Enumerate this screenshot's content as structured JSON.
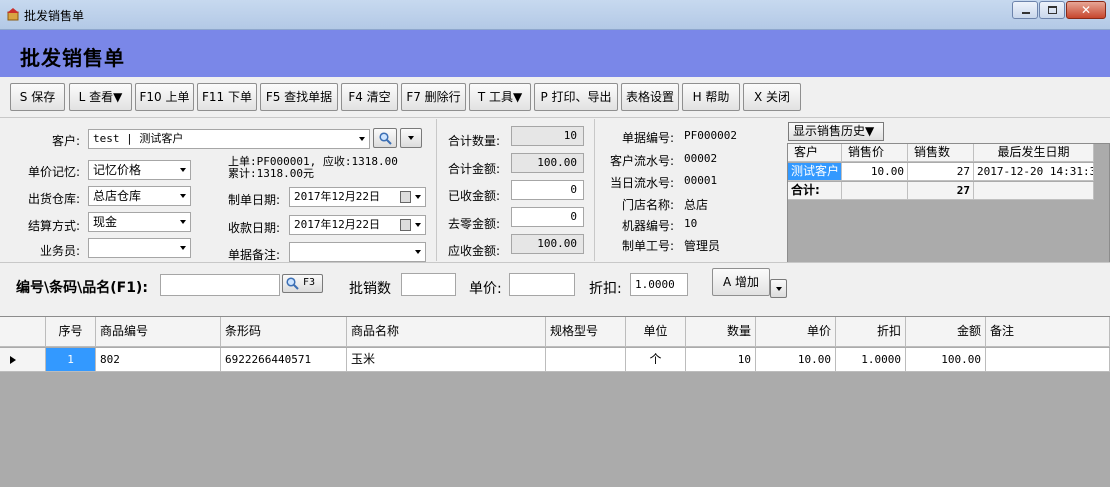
{
  "window": {
    "title": "批发销售单",
    "colors": {
      "header": "#7a87e8",
      "selected": "#3399ff"
    },
    "icons": [
      "app-icon",
      "minimize-icon",
      "maximize-icon",
      "close-icon"
    ]
  },
  "header": {
    "title": "批发销售单"
  },
  "toolbar": {
    "save": "S 保存",
    "view": "L 查看▼",
    "prev": "F10 上单",
    "next": "F11 下单",
    "find": "F5 查找单据",
    "clear": "F4 清空",
    "delete_row": "F7 删除行",
    "tools": "T 工具▼",
    "print": "P 打印、导出",
    "table_settings": "表格设置",
    "help": "H 帮助",
    "close": "X 关闭"
  },
  "form": {
    "customer_label": "客户:",
    "customer_value": "test | 测试客户",
    "price_memory_label": "单价记忆:",
    "price_memory_value": "记忆价格",
    "warehouse_label": "出货仓库:",
    "warehouse_value": "总店仓库",
    "settle_label": "结算方式:",
    "settle_value": "现金",
    "staff_label": "业务员:",
    "staff_value": "",
    "last_bill_line1": "上单:PF000001, 应收:1318.00",
    "last_bill_line2": "累计:1318.00元",
    "make_date_label": "制单日期:",
    "make_date_value": "2017年12月22日",
    "pay_date_label": "收款日期:",
    "pay_date_value": "2017年12月22日",
    "note_label": "单据备注:",
    "note_value": ""
  },
  "totals": {
    "qty_label": "合计数量:",
    "qty_value": "10",
    "amount_label": "合计金额:",
    "amount_value": "100.00",
    "received_label": "已收金额:",
    "received_value": "0",
    "rounding_label": "去零金额:",
    "rounding_value": "0",
    "receivable_label": "应收金额:",
    "receivable_value": "100.00"
  },
  "info": {
    "bill_no_label": "单据编号:",
    "bill_no_value": "PF000002",
    "cust_flow_label": "客户流水号:",
    "cust_flow_value": "00002",
    "day_flow_label": "当日流水号:",
    "day_flow_value": "00001",
    "store_label": "门店名称:",
    "store_value": "总店",
    "machine_label": "机器编号:",
    "machine_value": "10",
    "operator_label": "制单工号:",
    "operator_value": "管理员"
  },
  "history": {
    "button": "显示销售历史▼",
    "columns": [
      "客户",
      "销售价",
      "销售数",
      "最后发生日期"
    ],
    "row": [
      "测试客户",
      "10.00",
      "27",
      "2017-12-20 14:31:31"
    ],
    "total_label": "合计:",
    "total_qty": "27"
  },
  "entry": {
    "code_label": "编号\\条码\\品名(F1):",
    "code_value": "",
    "f3": "F3",
    "batch_label": "批销数",
    "batch_value": "",
    "price_label": "单价:",
    "price_value": "",
    "discount_label": "折扣:",
    "discount_value": "1.0000",
    "add_button": "A 增加"
  },
  "grid": {
    "columns": [
      "序号",
      "商品编号",
      "条形码",
      "商品名称",
      "规格型号",
      "单位",
      "数量",
      "单价",
      "折扣",
      "金额",
      "备注"
    ],
    "row": [
      "1",
      "802",
      "6922266440571",
      "玉米",
      "",
      "个",
      "10",
      "10.00",
      "1.0000",
      "100.00",
      ""
    ]
  }
}
